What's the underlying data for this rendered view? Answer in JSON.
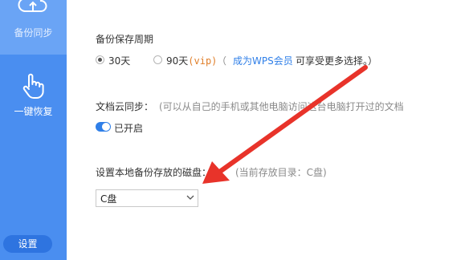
{
  "sidebar": {
    "items": [
      {
        "label": "备份同步",
        "icon": "cloud-upload-icon",
        "active": true
      },
      {
        "label": "一键恢复",
        "icon": "hand-pointer-icon",
        "active": false
      }
    ],
    "settings_label": "设置"
  },
  "backup_period": {
    "title": "备份保存周期",
    "options": [
      {
        "label": "30天",
        "selected": true
      },
      {
        "label": "90天",
        "tag": "(vip)",
        "selected": false
      }
    ],
    "note_open": "（",
    "note_link": "成为WPS会员",
    "note_text": "可享受更多选择。）"
  },
  "cloud_sync": {
    "title": "文档云同步：",
    "description": "(可以从自己的手机或其他电脑访问这台电脑打开过的文档",
    "toggle_on": true,
    "toggle_label": "已开启"
  },
  "local_disk": {
    "title": "设置本地备份存放的磁盘：",
    "current_dir": "(当前存放目录：C盘)",
    "selected_value": "C盘"
  },
  "colors": {
    "sidebar_bg": "#4a8ef0",
    "accent": "#2f7fe8",
    "annotation_arrow": "#e8332a"
  }
}
